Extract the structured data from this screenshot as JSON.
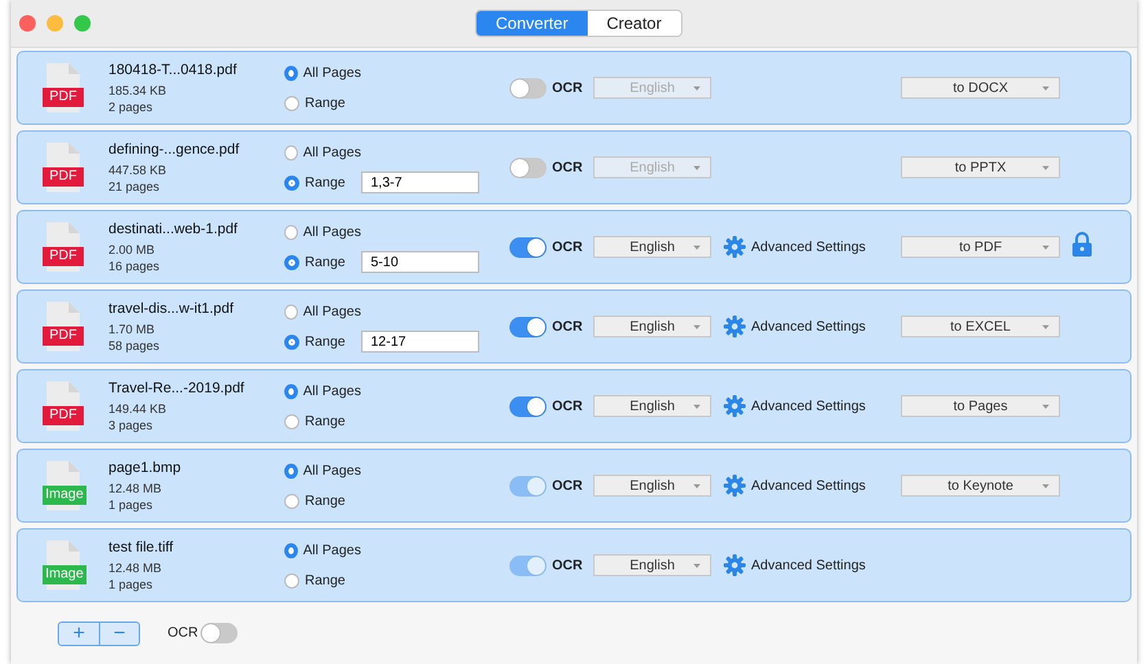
{
  "window": {
    "controls": [
      {
        "color": "#fc605c"
      },
      {
        "color": "#fdbc40"
      },
      {
        "color": "#34c84a"
      }
    ]
  },
  "tabs": [
    {
      "label": "Converter",
      "selected": true
    },
    {
      "label": "Creator",
      "selected": false
    }
  ],
  "files": [
    {
      "name": "180418-T...0418.pdf",
      "type": "PDF",
      "size": "185.34 KB",
      "pages": "2 pages",
      "all_pages": {
        "label": "All Pages",
        "selected": true
      },
      "range": {
        "label": "Range",
        "selected": false
      },
      "ocr": {
        "label": "OCR",
        "on": false,
        "disabled": false
      },
      "language": "English",
      "format": "to DOCX"
    },
    {
      "name": "defining-...gence.pdf",
      "type": "PDF",
      "size": "447.58 KB",
      "pages": "21 pages",
      "all_pages": {
        "label": "All Pages",
        "selected": false
      },
      "range": {
        "label": "Range",
        "selected": true,
        "value": "1,3-7"
      },
      "ocr": {
        "label": "OCR",
        "on": false,
        "disabled": false
      },
      "language": "English",
      "format": "to PPTX"
    },
    {
      "name": "destinati...web-1.pdf",
      "type": "PDF",
      "size": "2.00 MB",
      "pages": "16 pages",
      "all_pages": {
        "label": "All Pages",
        "selected": false
      },
      "range": {
        "label": "Range",
        "selected": true,
        "value": "5-10"
      },
      "ocr": {
        "label": "OCR",
        "on": true,
        "disabled": false
      },
      "language": "English",
      "advanced": "Advanced Settings",
      "format": "to PDF",
      "locked": true
    },
    {
      "name": "travel-dis...w-it1.pdf",
      "type": "PDF",
      "size": "1.70 MB",
      "pages": "58 pages",
      "all_pages": {
        "label": "All Pages",
        "selected": false
      },
      "range": {
        "label": "Range",
        "selected": true,
        "value": "12-17"
      },
      "ocr": {
        "label": "OCR",
        "on": true,
        "disabled": false
      },
      "language": "English",
      "advanced": "Advanced Settings",
      "format": "to EXCEL"
    },
    {
      "name": "Travel-Re...-2019.pdf",
      "type": "PDF",
      "size": "149.44 KB",
      "pages": "3 pages",
      "all_pages": {
        "label": "All Pages",
        "selected": true
      },
      "range": {
        "label": "Range",
        "selected": false
      },
      "ocr": {
        "label": "OCR",
        "on": true,
        "disabled": false
      },
      "language": "English",
      "advanced": "Advanced Settings",
      "format": "to Pages"
    },
    {
      "name": "page1.bmp",
      "type": "Image",
      "size": "12.48 MB",
      "pages": "1 pages",
      "all_pages": {
        "label": "All Pages",
        "selected": true
      },
      "range": {
        "label": "Range",
        "selected": false
      },
      "ocr": {
        "label": "OCR",
        "on": true,
        "disabled": true
      },
      "language": "English",
      "advanced": "Advanced Settings",
      "format": "to Keynote"
    },
    {
      "name": "test file.tiff",
      "type": "Image",
      "size": "12.48 MB",
      "pages": "1 pages",
      "all_pages": {
        "label": "All Pages",
        "selected": true
      },
      "range": {
        "label": "Range",
        "selected": false
      },
      "ocr": {
        "label": "OCR",
        "on": true,
        "disabled": true
      },
      "language": "English",
      "advanced": "Advanced Settings"
    }
  ],
  "footer": {
    "add": "+",
    "remove": "−",
    "ocr": {
      "label": "OCR",
      "on": false
    }
  }
}
